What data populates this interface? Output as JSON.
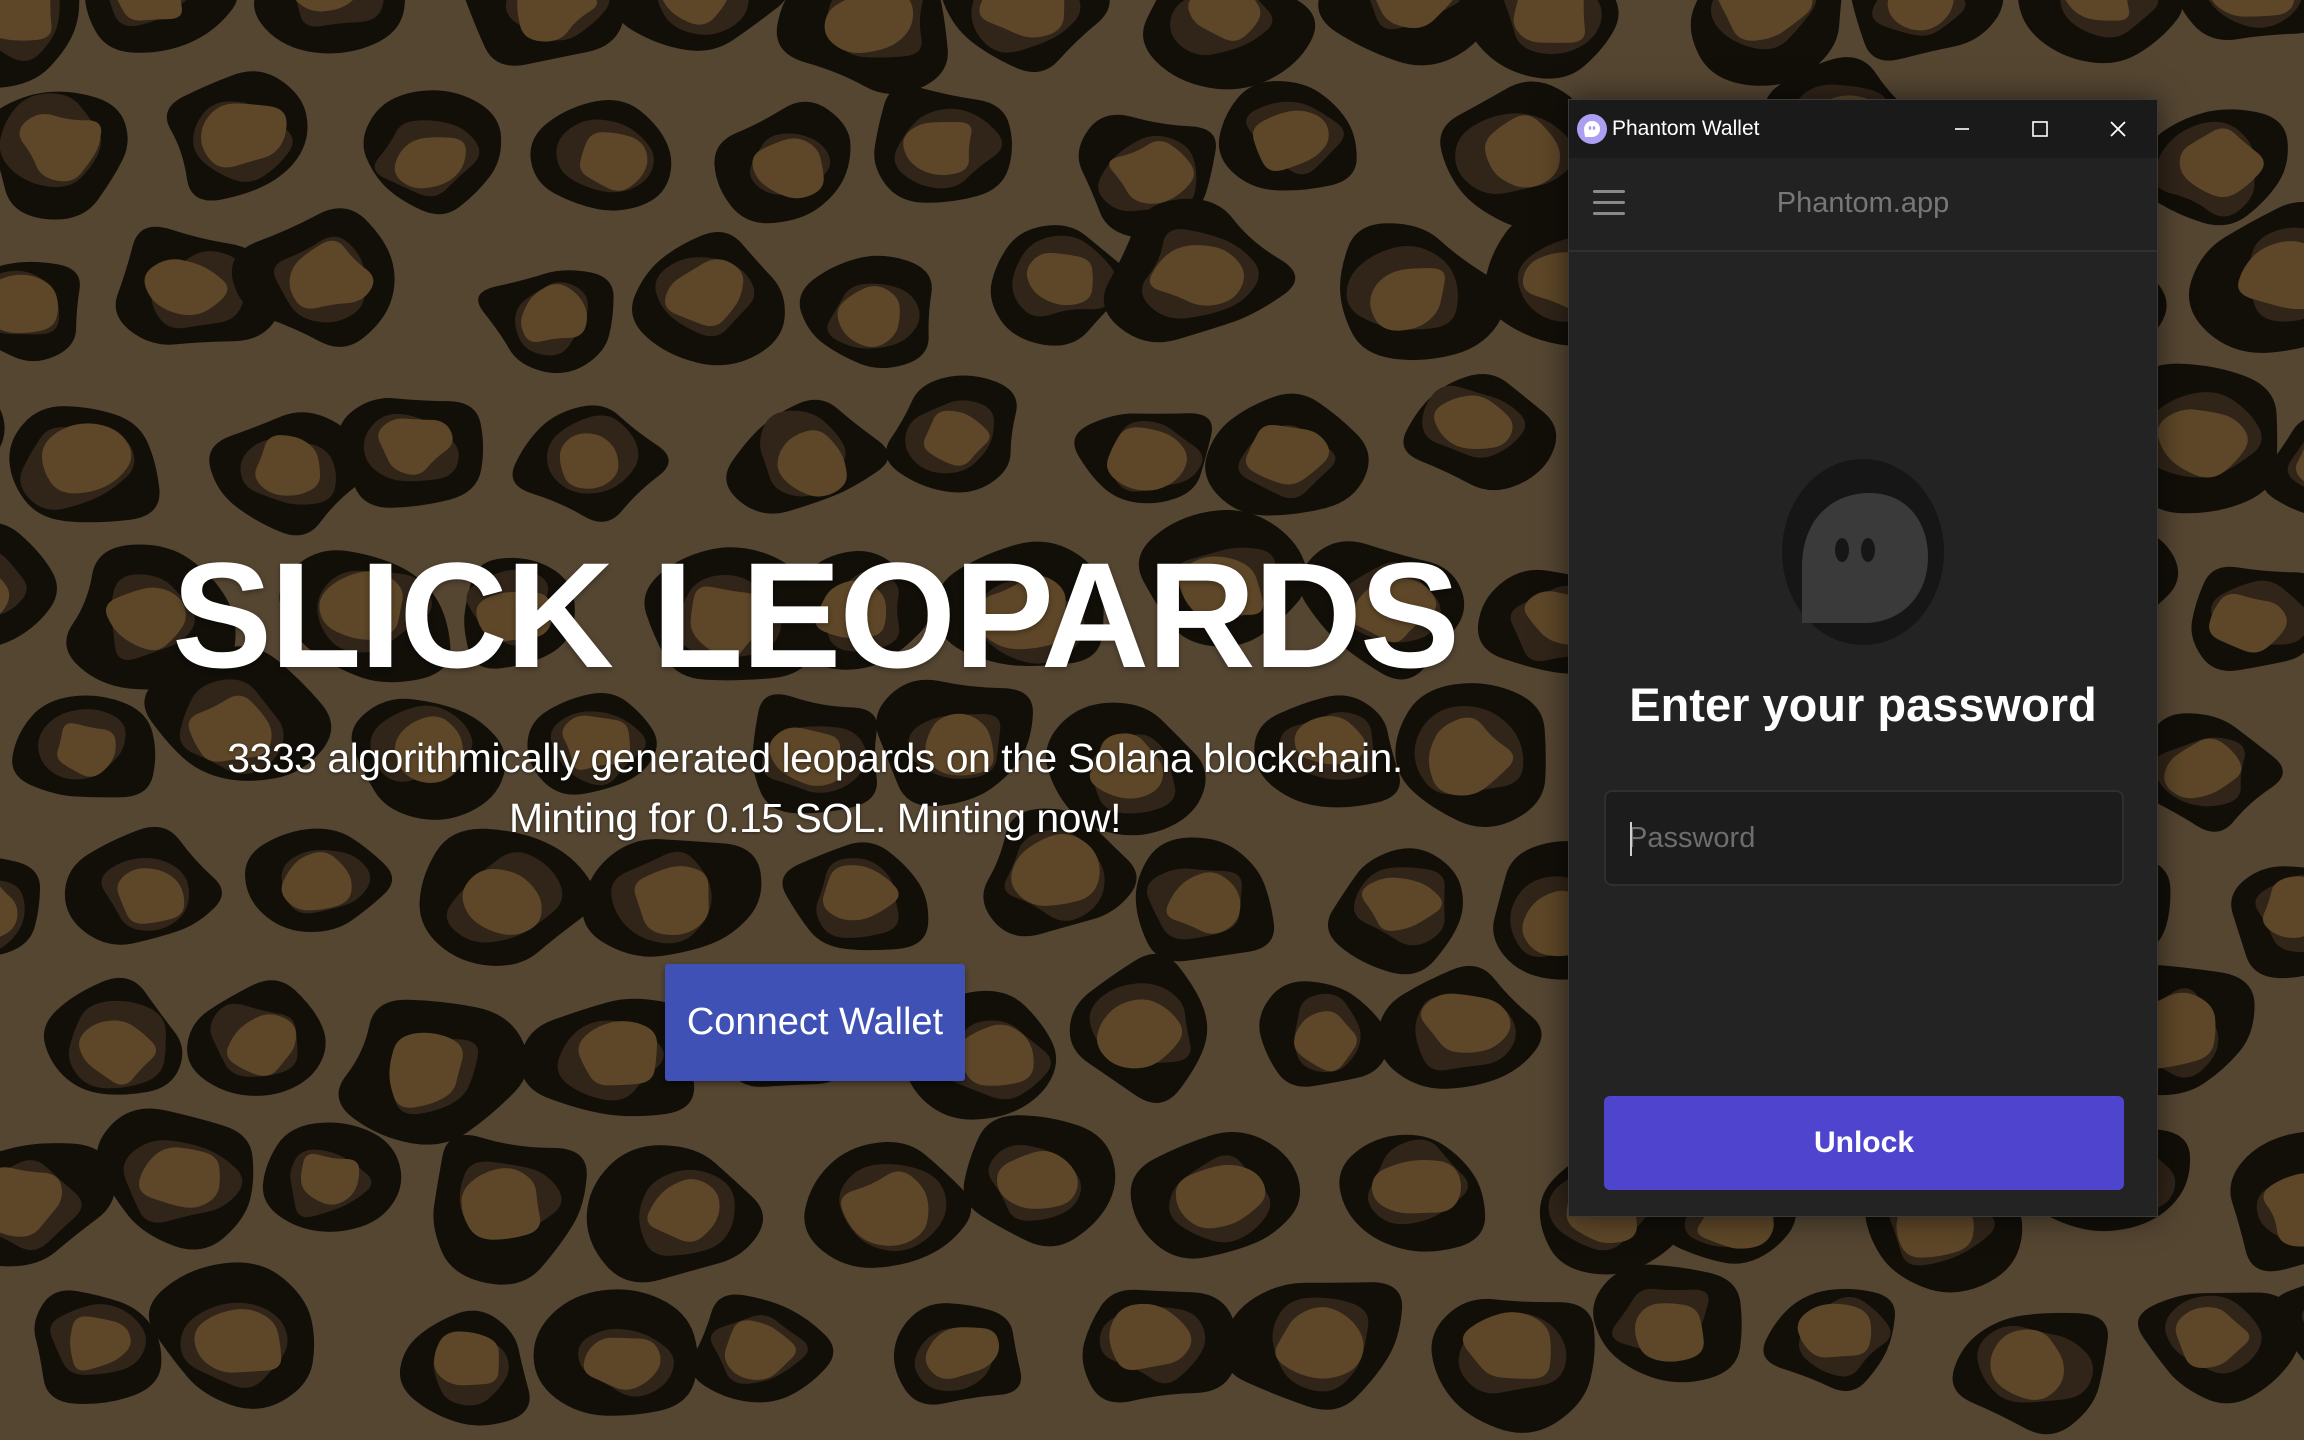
{
  "page": {
    "background_colors": {
      "base": "#6f5c42",
      "rosette_outer": "#121009",
      "rosette_inner": "#7c5e34",
      "rosette_shadow": "#3d2f1f"
    }
  },
  "hero": {
    "title": "SLICK LEOPARDS",
    "subtitle": "3333 algorithmically generated leopards on the Solana blockchain. Minting for 0.15 SOL. Minting now!",
    "connect_button": "Connect Wallet",
    "button_color": "#3f51b5"
  },
  "phantom": {
    "window_title": "Phantom Wallet",
    "app_url": "Phantom.app",
    "heading": "Enter your password",
    "password_placeholder": "Password",
    "password_value": "",
    "unlock_button": "Unlock",
    "accent_color": "#4e44ce",
    "logo_color": "#ab9ff2",
    "icons": {
      "logo": "phantom-ghost-icon",
      "minimize": "minimize-icon",
      "maximize": "maximize-icon",
      "close": "close-icon",
      "menu": "hamburger-menu-icon",
      "avatar": "phantom-ghost-icon"
    }
  }
}
